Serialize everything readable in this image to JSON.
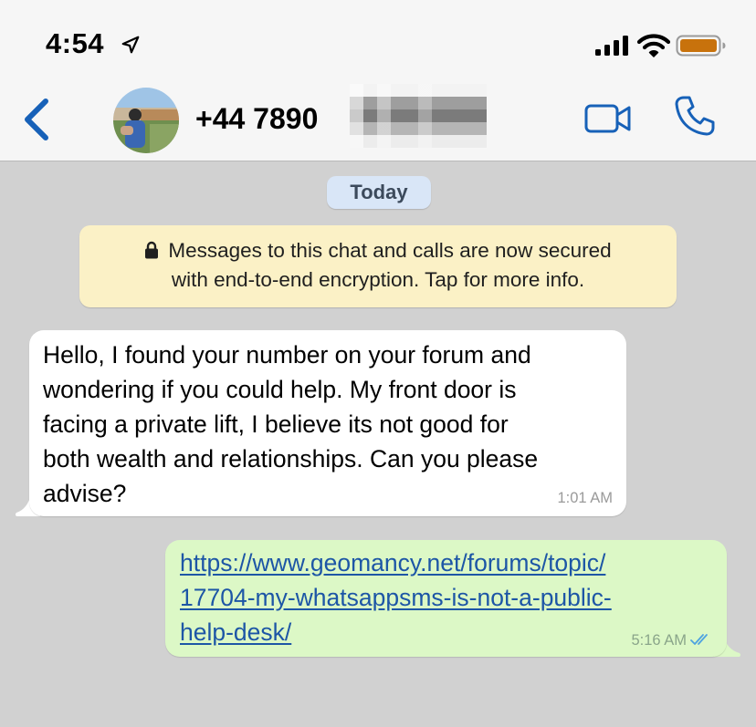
{
  "status_bar": {
    "time": "4:54",
    "icons": [
      "location-arrow-icon",
      "signal-bars-icon",
      "wifi-icon",
      "battery-icon"
    ],
    "battery_color": "#c8720c"
  },
  "header": {
    "back_icon": "chevron-left-icon",
    "contact_number": "+44 7890",
    "contact_redacted": true,
    "actions": [
      "video-call-icon",
      "voice-call-icon"
    ],
    "accent_color": "#1761b8"
  },
  "chat": {
    "date_label": "Today",
    "encryption_notice": {
      "line1": "Messages to this chat and calls are now secured",
      "line2": "with end-to-end encryption. Tap for more info.",
      "icon": "lock-icon"
    },
    "messages": [
      {
        "direction": "incoming",
        "text_lines": [
          "Hello, I found your number on your forum and",
          "wondering if you could help. My front door is",
          "facing a private lift, I believe its not good for",
          "both wealth and relationships. Can you please",
          "advise?"
        ],
        "time": "1:01 AM"
      },
      {
        "direction": "outgoing",
        "link_lines": [
          "https://www.geomancy.net/forums/topic/",
          "17704-my-whatsappsms-is-not-a-public-",
          "help-desk/"
        ],
        "time": "5:16 AM",
        "status_icon": "double-check-icon",
        "status_color": "#4fa3e0"
      }
    ]
  }
}
